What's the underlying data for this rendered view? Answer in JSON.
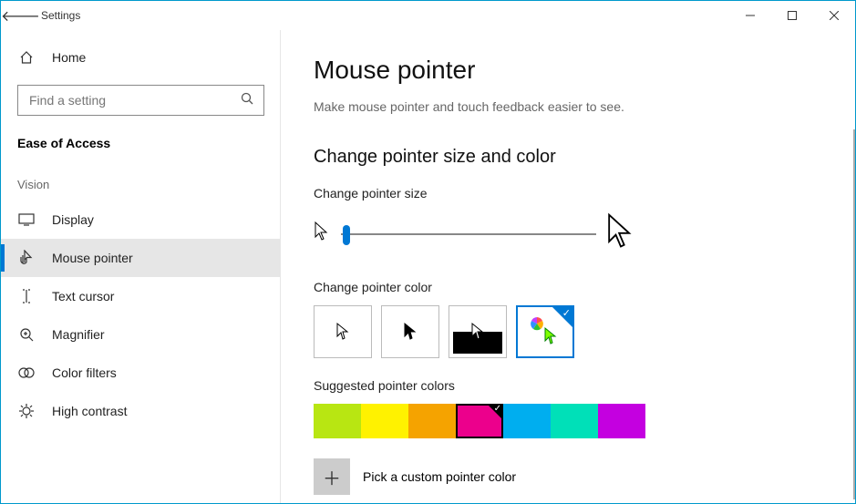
{
  "titlebar": {
    "title": "Settings"
  },
  "sidebar": {
    "home_label": "Home",
    "search_placeholder": "Find a setting",
    "category_label": "Ease of Access",
    "group_label": "Vision",
    "items": [
      {
        "label": "Display"
      },
      {
        "label": "Mouse pointer"
      },
      {
        "label": "Text cursor"
      },
      {
        "label": "Magnifier"
      },
      {
        "label": "Color filters"
      },
      {
        "label": "High contrast"
      }
    ],
    "selected_index": 1
  },
  "page": {
    "heading": "Mouse pointer",
    "description": "Make mouse pointer and touch feedback easier to see.",
    "section_heading": "Change pointer size and color",
    "size_label": "Change pointer size",
    "color_label": "Change pointer color",
    "color_option_selected": 3,
    "suggested_label": "Suggested pointer colors",
    "suggested_colors": [
      "#b8e612",
      "#fff200",
      "#f5a300",
      "#ec008c",
      "#00aeef",
      "#00e0b8",
      "#c400e0"
    ],
    "suggested_selected": 3,
    "custom_label": "Pick a custom pointer color"
  }
}
